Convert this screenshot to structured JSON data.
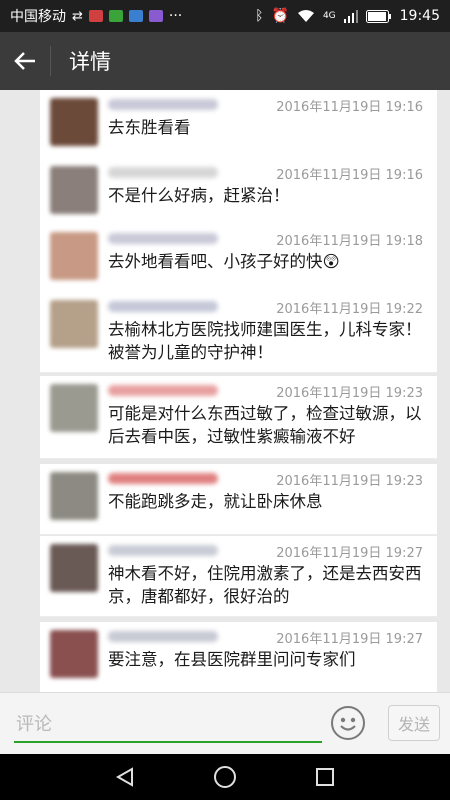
{
  "status": {
    "carrier": "中国移动",
    "time": "19:45",
    "network": "4G"
  },
  "header": {
    "title": "详情"
  },
  "comments": [
    {
      "time": "2016年11月19日 19:16",
      "text": "去东胜看看",
      "avatar_color": "#6b4a3a",
      "name_color": "#c8c8d8"
    },
    {
      "time": "2016年11月19日 19:16",
      "text": "不是什么好病，赶紧治！",
      "avatar_color": "#8a7f7a",
      "name_color": "#d6d6d6"
    },
    {
      "time": "2016年11月19日 19:18",
      "text": "去外地看看吧、小孩子好的快😲",
      "avatar_color": "#c89a85",
      "name_color": "#c9c9d8"
    },
    {
      "time": "2016年11月19日 19:22",
      "text": "去榆林北方医院找师建国医生，儿科专家！被誉为儿童的守护神！",
      "avatar_color": "#b5a08a",
      "name_color": "#c4c8d8"
    },
    {
      "time": "2016年11月19日 19:23",
      "text": "可能是对什么东西过敏了，检查过敏源，以后去看中医，过敏性紫癜输液不好",
      "avatar_color": "#9a9a90",
      "name_color": "#e8a0a0"
    },
    {
      "time": "2016年11月19日 19:23",
      "text": "不能跑跳多走，就让卧床休息",
      "avatar_color": "#8c8a82",
      "name_color": "#e08080"
    },
    {
      "time": "2016年11月19日 19:27",
      "text": "神木看不好，住院用激素了，还是去西安西京，唐都都好，很好治的",
      "avatar_color": "#6a5a55",
      "name_color": "#c9ccd6"
    },
    {
      "time": "2016年11月19日 19:27",
      "text": "要注意，在县医院群里问问专家们",
      "avatar_color": "#8a5050",
      "name_color": "#c7c9d4"
    }
  ],
  "input": {
    "placeholder": "评论",
    "value": ""
  },
  "send_label": "发送",
  "colors": {
    "accent": "#2aa22a",
    "title_bar": "#3b3b3b",
    "status_bar": "#1f1f1f"
  },
  "icons": {
    "back": "back-arrow-icon",
    "emoji": "smiley-icon"
  }
}
